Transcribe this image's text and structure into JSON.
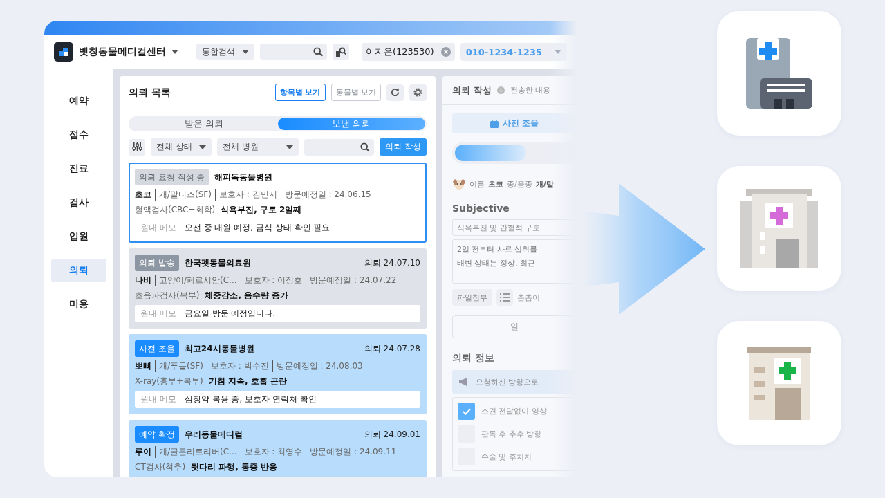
{
  "app": {
    "name": "벳칭동물메디컬센터"
  },
  "search": {
    "scope": "통합검색"
  },
  "patient": {
    "name": "이지은(123530)",
    "phone": "010-1234-1235"
  },
  "sidebar": {
    "items": [
      {
        "label": "예약",
        "selected": false
      },
      {
        "label": "접수",
        "selected": false
      },
      {
        "label": "진료",
        "selected": false
      },
      {
        "label": "검사",
        "selected": false
      },
      {
        "label": "입원",
        "selected": false
      },
      {
        "label": "의뢰",
        "selected": true
      },
      {
        "label": "미용",
        "selected": false
      }
    ]
  },
  "referral_list": {
    "title": "의뢰 목록",
    "view_buttons": [
      {
        "label": "항목별 보기",
        "selected": true
      },
      {
        "label": "동물별 보기",
        "selected": false
      }
    ],
    "tabs": [
      {
        "label": "받은 의뢰",
        "selected": false
      },
      {
        "label": "보낸 의뢰",
        "selected": true
      }
    ],
    "filters": [
      "전체 상태",
      "전체 병원"
    ],
    "write_button": "의뢰 작성",
    "cards": [
      {
        "kind": "draft",
        "status": "의뢰 요청 작성 중",
        "hospital": "해피독동물병원",
        "selected": true,
        "pet": "초코",
        "details": [
          "개/말티즈(SF)",
          "보호자 : 김민지",
          "방문예정일 : 24.06.15"
        ],
        "test": "혈액검사(CBC+화학)",
        "symptom": "식욕부진, 구토 2일째",
        "memo_label": "원내 메모",
        "memo": "오전 중 내원 예정, 금식 상태 확인 필요"
      },
      {
        "kind": "sent",
        "status": "의뢰 발송",
        "hospital": "한국펫동물의료원",
        "date": "의뢰 24.07.10",
        "selected": false,
        "pet": "나비",
        "details": [
          "고양이/페르시안(C...",
          "보호자 : 이정호",
          "방문예정일 : 24.07.22"
        ],
        "test": "초음파검사(복부)",
        "symptom": "체중감소, 음수량 증가",
        "memo_label": "원내 메모",
        "memo": "금요일 방문 예정입니다."
      },
      {
        "kind": "coordinating",
        "status": "사전 조율",
        "hospital": "최고24시동물병원",
        "date": "의뢰 24.07.28",
        "selected": false,
        "pet": "뽀삐",
        "details": [
          "개/푸들(SF)",
          "보호자 : 박수진",
          "방문예정일 : 24.08.03"
        ],
        "test": "X-ray(흉부+복부)",
        "symptom": "기침 지속, 호흡 곤란",
        "memo_label": "원내 메모",
        "memo": "심장약 복용 중, 보호자 연락처 확인"
      },
      {
        "kind": "confirmed",
        "status": "예약 확정",
        "hospital": "우리동물메디컬",
        "date": "의뢰 24.09.01",
        "selected": false,
        "pet": "루이",
        "details": [
          "개/골든리트리버(C...",
          "보호자 : 최영수",
          "방문예정일 : 24.09.11"
        ],
        "test": "CT검사(척추)",
        "symptom": "뒷다리 파행, 통증 반응"
      }
    ]
  },
  "referral_form": {
    "title": "의뢰 작성",
    "notice": "전송한 내용",
    "stage_button": "사전 조율",
    "pet_fields": [
      {
        "label": "이름",
        "value": "초코"
      },
      {
        "label": "종/품종",
        "value": "개/말"
      }
    ],
    "subjective_title": "Subjective",
    "summary": "식욕부진 및 간헐적 구토",
    "description_lines": [
      "2일 전부터 사료 섭취를",
      "배변 상태는 정상. 최근"
    ],
    "attach_button": "파일첨부",
    "hint": "촘촘이",
    "select": "일",
    "info_title": "의뢰 정보",
    "request_notice": "요청하신 방향으로",
    "options": [
      {
        "label": "소견 전달없이 영상",
        "checked": true
      },
      {
        "label": "판독 후 추후 방향",
        "checked": false
      },
      {
        "label": "수술 및 후처치",
        "checked": false
      }
    ]
  }
}
